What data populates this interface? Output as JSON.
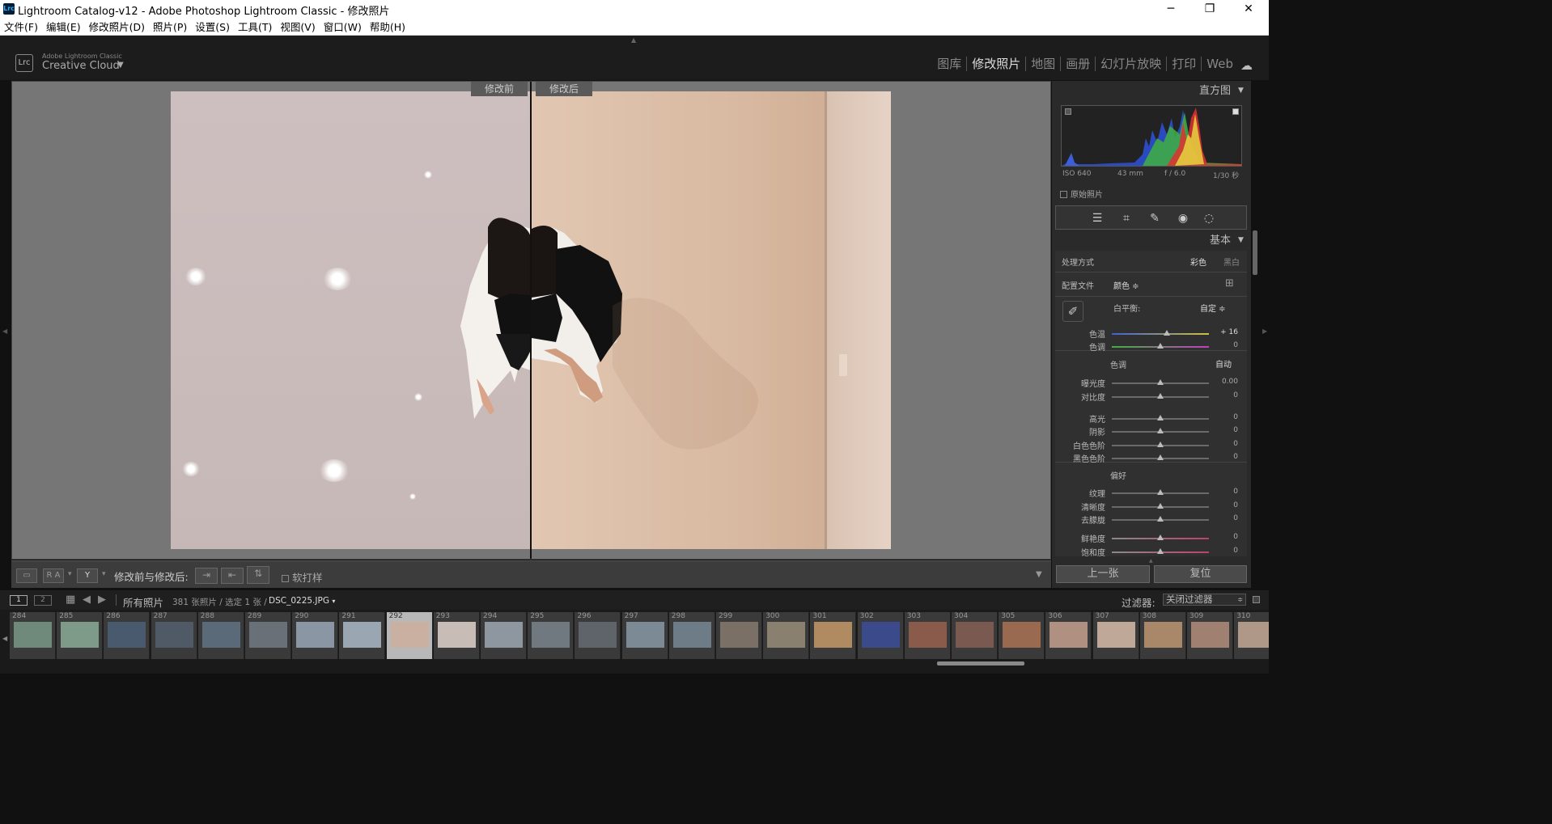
{
  "window": {
    "title": "Lightroom Catalog-v12 - Adobe Photoshop Lightroom Classic - 修改照片",
    "app_icon": "Lrc",
    "controls": [
      "─",
      "❐",
      "✕"
    ]
  },
  "menu": [
    "文件(F)",
    "编辑(E)",
    "修改照片(D)",
    "照片(P)",
    "设置(S)",
    "工具(T)",
    "视图(V)",
    "窗口(W)",
    "帮助(H)"
  ],
  "identity": {
    "logo": "Lrc",
    "brand_small": "Adobe Lightroom Classic",
    "brand": "Creative Cloud",
    "arrow": "▼"
  },
  "modules": [
    {
      "label": "图库",
      "active": false
    },
    {
      "label": "修改照片",
      "active": true
    },
    {
      "label": "地图",
      "active": false
    },
    {
      "label": "画册",
      "active": false
    },
    {
      "label": "幻灯片放映",
      "active": false
    },
    {
      "label": "打印",
      "active": false
    },
    {
      "label": "Web",
      "active": false
    }
  ],
  "viewer": {
    "before_label": "修改前",
    "after_label": "修改后"
  },
  "toolbar": {
    "compare_label": "修改前与修改后:",
    "soft_proof": "软打样",
    "ra_button": "R A",
    "y_button": "Y"
  },
  "right_panel": {
    "histogram_title": "直方图",
    "exif": {
      "iso": "ISO 640",
      "focal": "43 mm",
      "aperture": "f / 6.0",
      "shutter": "1/30 秒"
    },
    "original_photo": "原始照片",
    "basic_title": "基本",
    "treatment": {
      "label": "处理方式",
      "color": "彩色",
      "bw": "黑白"
    },
    "profile": {
      "label": "配置文件",
      "value": "颜色 ≑"
    },
    "white_balance": {
      "label": "白平衡:",
      "value": "自定 ≑"
    },
    "tone_label": "色调",
    "auto": "自动",
    "presence_label": "偏好",
    "sliders": [
      {
        "label": "色温",
        "value": "+ 16",
        "fraction": 0.57
      },
      {
        "label": "色调",
        "value": "0",
        "fraction": 0.5
      },
      {
        "label": "曝光度",
        "value": "0.00",
        "fraction": 0.5
      },
      {
        "label": "对比度",
        "value": "0",
        "fraction": 0.5
      },
      {
        "label": "高光",
        "value": "0",
        "fraction": 0.5
      },
      {
        "label": "阴影",
        "value": "0",
        "fraction": 0.5
      },
      {
        "label": "白色色阶",
        "value": "0",
        "fraction": 0.5
      },
      {
        "label": "黑色色阶",
        "value": "0",
        "fraction": 0.5
      },
      {
        "label": "纹理",
        "value": "0",
        "fraction": 0.5
      },
      {
        "label": "清晰度",
        "value": "0",
        "fraction": 0.5
      },
      {
        "label": "去朦胧",
        "value": "0",
        "fraction": 0.5
      },
      {
        "label": "鲜艳度",
        "value": "0",
        "fraction": 0.5
      },
      {
        "label": "饱和度",
        "value": "0",
        "fraction": 0.5
      }
    ],
    "prev_button": "上一张",
    "reset_button": "复位"
  },
  "filmstrip_bar": {
    "screen1": "1",
    "screen2": "2",
    "source": "所有照片",
    "count": "381 张照片 / 选定 1 张 /",
    "filename": "DSC_0225.JPG",
    "filter_label": "过滤器:",
    "filter_value": "关闭过滤器"
  },
  "filmstrip": [
    {
      "num": "284",
      "color": "#6f8a7a"
    },
    {
      "num": "285",
      "color": "#7e9a88"
    },
    {
      "num": "286",
      "color": "#4a5a6e"
    },
    {
      "num": "287",
      "color": "#4f5a66"
    },
    {
      "num": "288",
      "color": "#5b6a78"
    },
    {
      "num": "289",
      "color": "#6a7078"
    },
    {
      "num": "290",
      "color": "#8a96a4"
    },
    {
      "num": "291",
      "color": "#9aa6b2"
    },
    {
      "num": "292",
      "color": "#c9b0a0",
      "selected": true
    },
    {
      "num": "293",
      "color": "#c8bcb6"
    },
    {
      "num": "294",
      "color": "#8e96a0"
    },
    {
      "num": "295",
      "color": "#707880"
    },
    {
      "num": "296",
      "color": "#5e646a"
    },
    {
      "num": "297",
      "color": "#7c8a96"
    },
    {
      "num": "298",
      "color": "#6e7c88"
    },
    {
      "num": "299",
      "color": "#7a7066"
    },
    {
      "num": "300",
      "color": "#8a8070"
    },
    {
      "num": "301",
      "color": "#b08a60"
    },
    {
      "num": "302",
      "color": "#3a4a8a"
    },
    {
      "num": "303",
      "color": "#8a5a4a"
    },
    {
      "num": "304",
      "color": "#7a5a50"
    },
    {
      "num": "305",
      "color": "#9a6a50"
    },
    {
      "num": "306",
      "color": "#b09080"
    },
    {
      "num": "307",
      "color": "#c0a898"
    },
    {
      "num": "308",
      "color": "#a88868"
    },
    {
      "num": "309",
      "color": "#a08070"
    },
    {
      "num": "310",
      "color": "#b09888"
    }
  ]
}
